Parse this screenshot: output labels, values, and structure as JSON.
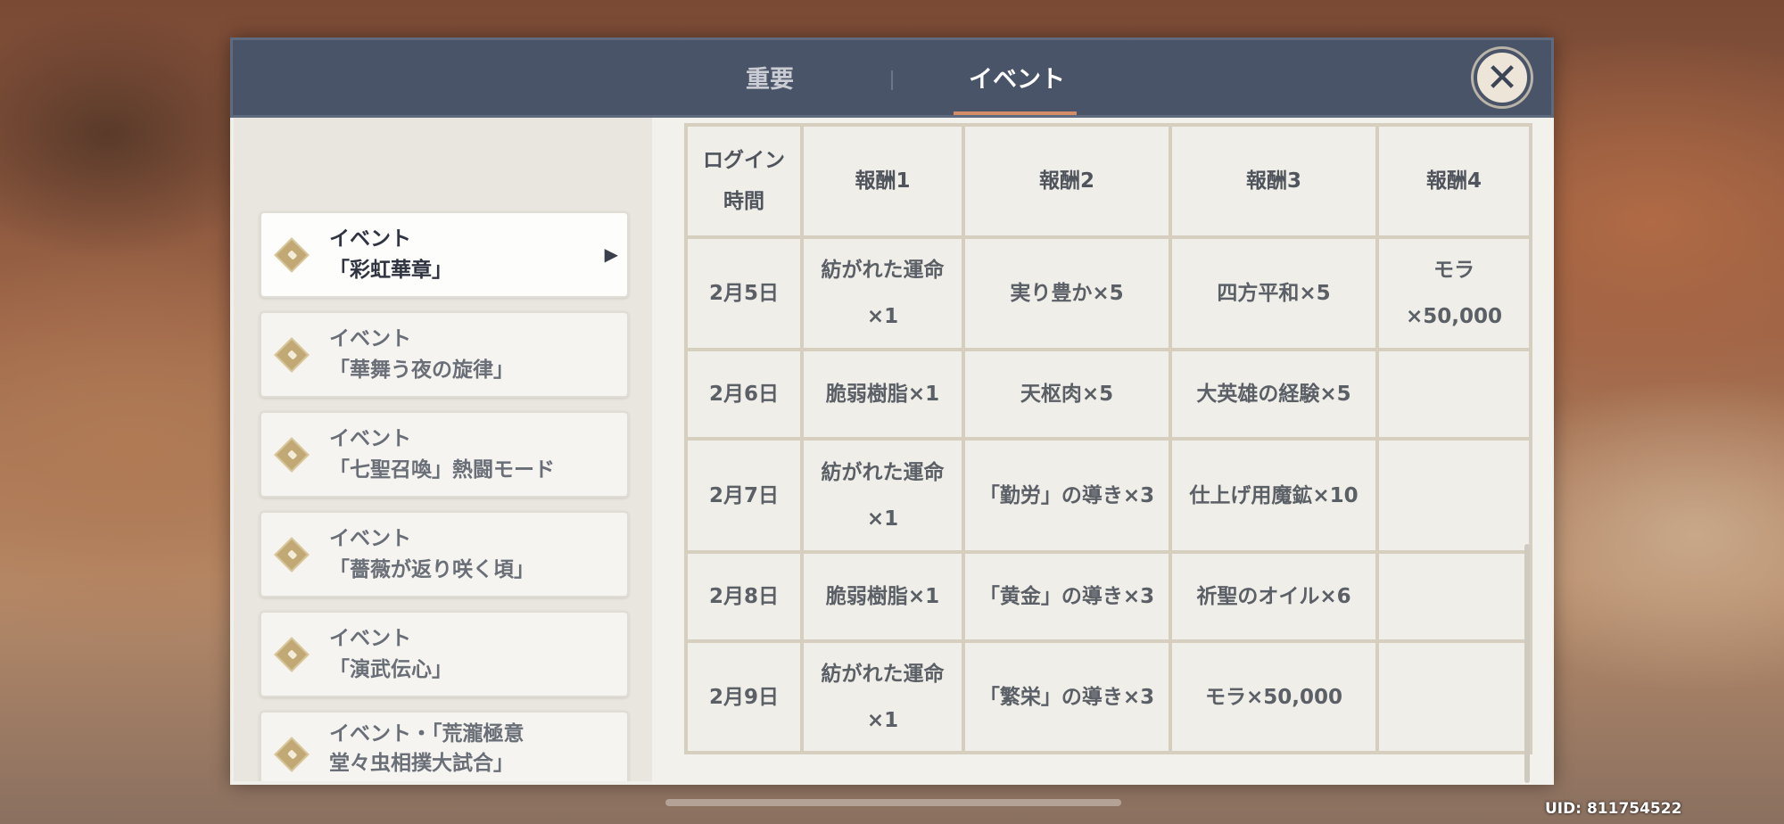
{
  "tabs": [
    {
      "label": "重要"
    },
    {
      "label": "イベント"
    }
  ],
  "close_icon": "✕",
  "events": [
    {
      "line1": "イベント",
      "line2": "「彩虹華章」"
    },
    {
      "line1": "イベント",
      "line2": "「華舞う夜の旋律」"
    },
    {
      "line1": "イベント",
      "line2": "「七聖召喚」熱闘モード"
    },
    {
      "line1": "イベント",
      "line2": "「薔薇が返り咲く頃」"
    },
    {
      "line1": "イベント",
      "line2": "「演武伝心」"
    },
    {
      "line1": "イベント・「荒瀧極意",
      "line2": "堂々虫相撲大試合」"
    }
  ],
  "table": {
    "headers": [
      "ログイン時間",
      "報酬1",
      "報酬2",
      "報酬3",
      "報酬4"
    ],
    "rows": [
      [
        "2月5日",
        "紡がれた運命×1",
        "実り豊か×5",
        "四方平和×5",
        "モラ×50,000"
      ],
      [
        "2月6日",
        "脆弱樹脂×1",
        "天枢肉×5",
        "大英雄の経験×5",
        ""
      ],
      [
        "2月7日",
        "紡がれた運命×1",
        "「勤労」の導き×3",
        "仕上げ用魔鉱×10",
        ""
      ],
      [
        "2月8日",
        "脆弱樹脂×1",
        "「黄金」の導き×3",
        "祈聖のオイル×6",
        ""
      ],
      [
        "2月9日",
        "紡がれた運命×1",
        "「繁栄」の導き×3",
        "モラ×50,000",
        ""
      ]
    ]
  },
  "uid": "UID: 811754522"
}
